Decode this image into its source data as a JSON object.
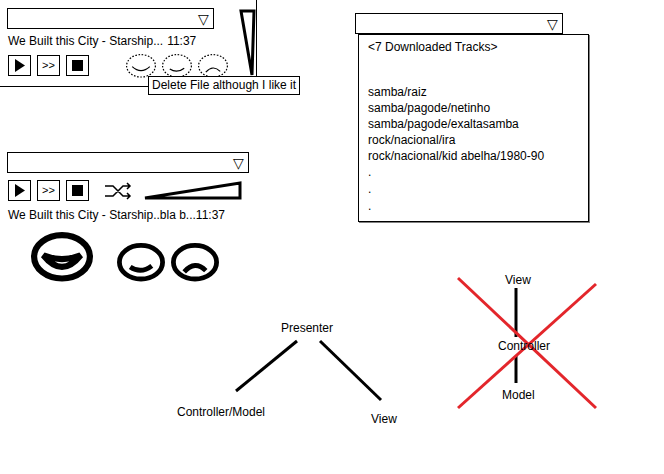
{
  "player_compact": {
    "dropdown": {
      "value": "",
      "arrow": "▽"
    },
    "buttons": [
      {
        "kind": "play",
        "label": ""
      },
      {
        "kind": "next",
        "label": ">>"
      },
      {
        "kind": "stop",
        "label": ""
      }
    ],
    "track": "We Built this City - Starship...",
    "time": "11:37",
    "ratings": [
      {
        "kind": "happy"
      },
      {
        "kind": "smile"
      },
      {
        "kind": "sad"
      }
    ],
    "tooltip": "Delete File although I like it"
  },
  "player_wide": {
    "dropdown": {
      "value": "",
      "arrow": "▽"
    },
    "buttons": [
      {
        "kind": "play",
        "label": ""
      },
      {
        "kind": "next",
        "label": ">>"
      },
      {
        "kind": "stop",
        "label": ""
      }
    ],
    "track": "We Built this City - Starship..bla b...",
    "time": "11:37",
    "ratings": [
      {
        "kind": "happy"
      },
      {
        "kind": "smile"
      },
      {
        "kind": "sad"
      }
    ]
  },
  "downloads": {
    "dropdown": {
      "value": "",
      "arrow": "▽"
    },
    "header": "<7 Downloaded Tracks>",
    "items": [
      "samba/raiz",
      "samba/pagode/netinho",
      "samba/pagode/exaltasamba",
      "rock/nacional/ira",
      "rock/nacional/kid abelha/1980-90"
    ],
    "more": [
      ".",
      ".",
      "."
    ]
  },
  "mvp_diagram": {
    "top": "Presenter",
    "left": "Controller/Model",
    "right": "View"
  },
  "mvc_diagram": {
    "top": "View",
    "middle": "Controller",
    "bottom": "Model",
    "crossed": true
  }
}
